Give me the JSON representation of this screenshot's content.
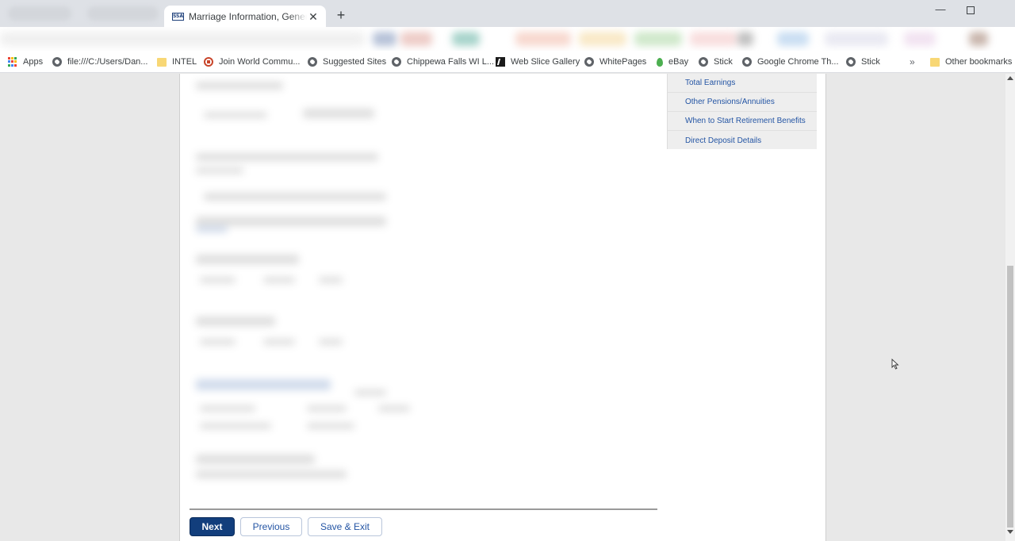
{
  "browser": {
    "tab": {
      "favicon_text": "SSA",
      "title": "Marriage Information, General A"
    },
    "new_tab_glyph": "+",
    "close_glyph": "✕",
    "window_minimize_glyph": "—"
  },
  "bookmarks": {
    "items": [
      {
        "label": "Apps",
        "icon": "apps-icon"
      },
      {
        "label": "file:///C:/Users/Dan...",
        "icon": "globe-icon"
      },
      {
        "label": "INTEL",
        "icon": "folder-icon"
      },
      {
        "label": "Join World Commu...",
        "icon": "join-icon"
      },
      {
        "label": "Suggested Sites",
        "icon": "globe-icon"
      },
      {
        "label": "Chippewa Falls WI L...",
        "icon": "globe-icon"
      },
      {
        "label": "Web Slice Gallery",
        "icon": "webslice-icon"
      },
      {
        "label": "WhitePages",
        "icon": "globe-icon"
      },
      {
        "label": "eBay",
        "icon": "ebay-icon"
      },
      {
        "label": "Stick",
        "icon": "globe-icon"
      },
      {
        "label": "Google Chrome Th...",
        "icon": "globe-icon"
      },
      {
        "label": "Stick",
        "icon": "globe-icon"
      }
    ],
    "overflow_glyph": "»",
    "other_bookmarks": "Other bookmarks"
  },
  "side_nav": {
    "items": [
      "Total Earnings",
      "Other Pensions/Annuities",
      "When to Start Retirement Benefits",
      "Direct Deposit Details"
    ]
  },
  "actions": {
    "next_label": "Next",
    "previous_label": "Previous",
    "save_exit_label": "Save & Exit"
  },
  "colors": {
    "primary_button": "#123e7c",
    "link": "#2455a4",
    "page_background": "#e8e8e8"
  }
}
